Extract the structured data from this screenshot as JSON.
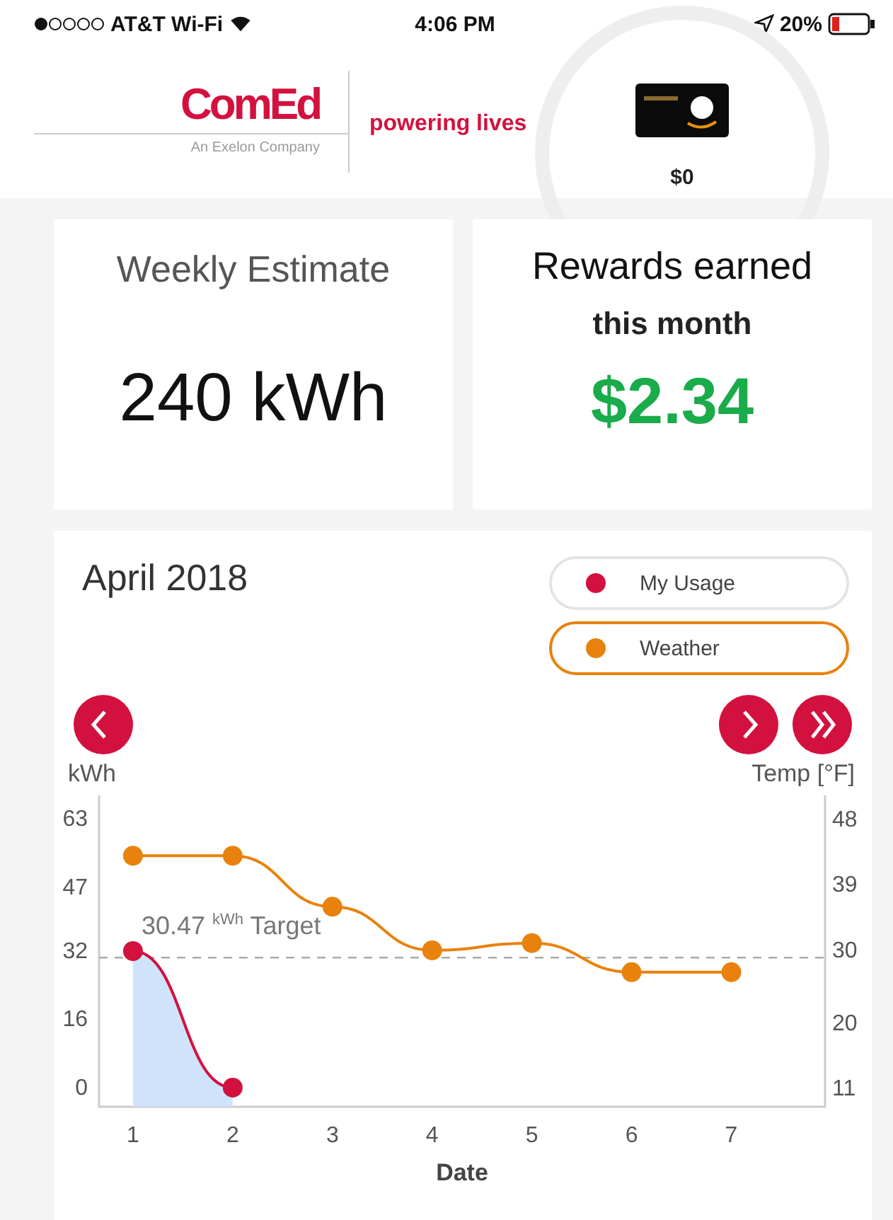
{
  "status_bar": {
    "carrier": "AT&T Wi-Fi",
    "time": "4:06 PM",
    "battery": "20%"
  },
  "header": {
    "brand": "ComEd",
    "brand_sub": "An Exelon Company",
    "tagline": "powering lives",
    "reward_amount": "$0"
  },
  "cards": [
    {
      "kind": "estimate",
      "title": "Weekly Estimate",
      "value": "240 kWh"
    },
    {
      "kind": "rewards",
      "title": "Rewards earned",
      "subtitle": "this month",
      "value": "$2.34"
    }
  ],
  "usage_panel": {
    "month": "April 2018",
    "legend": [
      {
        "color": "#d3113f",
        "selected": false
      },
      {
        "color": "#e8820c",
        "selected": true
      }
    ],
    "nav": [
      {
        "kind": "prev"
      },
      {
        "kind": "next"
      },
      {
        "kind": "last"
      }
    ],
    "chart_data": {
      "type": "line",
      "xlabel": "Date",
      "ylabel": "kWh",
      "y2label": "Temp [°F]",
      "x": [
        1,
        2,
        3,
        4,
        5,
        6,
        7
      ],
      "xlim": [
        0.66,
        7.94
      ],
      "ylim": [
        -4.5,
        68.5
      ],
      "y2lim": [
        8.5,
        51.3
      ],
      "xticks": [
        1,
        2,
        3,
        4,
        5,
        6,
        7
      ],
      "yticks": [
        0,
        16,
        32,
        47,
        63
      ],
      "y2ticks": [
        11,
        20,
        30,
        39,
        48
      ],
      "series": [
        {
          "name": "My Usage",
          "color": "#d3113f",
          "marker": "circle",
          "values": [
            32,
            0,
            null,
            null,
            null,
            null,
            null
          ]
        },
        {
          "name": "Weather",
          "color": "#e8820c",
          "axis": "y2",
          "marker": "circle",
          "values": [
            43,
            43,
            36,
            30,
            31,
            27,
            27
          ]
        }
      ],
      "ref_lines": [
        {
          "axis": "y",
          "value": 30.47,
          "label": "30.47 $^{kWh}$ Target"
        }
      ]
    }
  }
}
